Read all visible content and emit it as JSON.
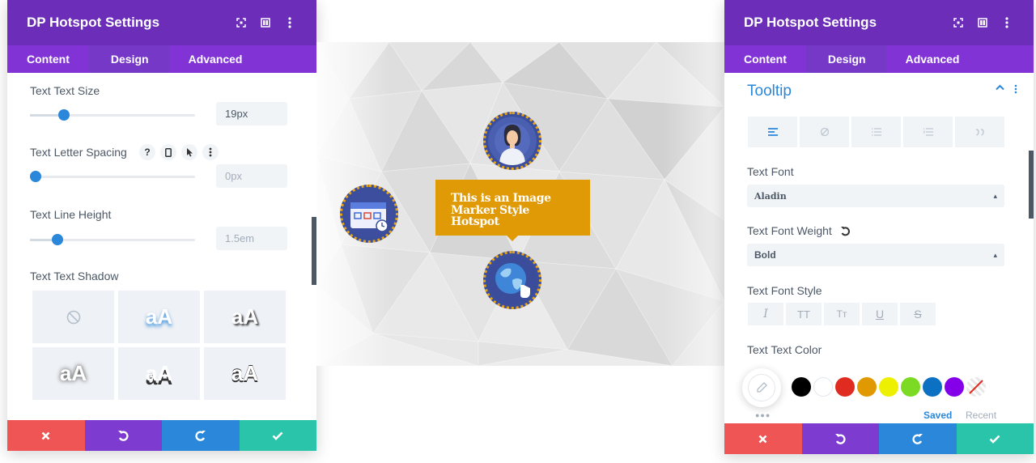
{
  "left_panel": {
    "title": "DP Hotspot Settings",
    "tabs": [
      {
        "label": "Content"
      },
      {
        "label": "Design"
      },
      {
        "label": "Advanced"
      }
    ],
    "text_size": {
      "label": "Text Text Size",
      "value": "19px",
      "slider_fraction": 0.2
    },
    "letter_spacing": {
      "label": "Text Letter Spacing",
      "value": "0px",
      "slider_fraction": 0.03
    },
    "line_height": {
      "label": "Text Line Height",
      "value": "1.5em",
      "slider_fraction": 0.17
    },
    "text_shadow": {
      "label": "Text Text Shadow",
      "presets": [
        "aA",
        "aA",
        "aA",
        "aA",
        "aA"
      ]
    }
  },
  "canvas": {
    "tooltip_text": "This is an Image Marker Style Hotspot"
  },
  "right_panel": {
    "title": "DP Hotspot Settings",
    "tabs": [
      {
        "label": "Content"
      },
      {
        "label": "Design"
      },
      {
        "label": "Advanced"
      }
    ],
    "section": "Tooltip",
    "text_font": {
      "label": "Text Font",
      "value": "Aladin"
    },
    "font_weight": {
      "label": "Text Font Weight",
      "value": "Bold"
    },
    "font_style": {
      "label": "Text Font Style",
      "buttons": [
        "I",
        "TT",
        "Tт",
        "U",
        "S"
      ]
    },
    "text_color": {
      "label": "Text Text Color",
      "swatches": [
        "#000000",
        "#ffffff",
        "#e02b20",
        "#e09900",
        "#edf000",
        "#7cda24",
        "#0c71c3",
        "#8300e9"
      ],
      "saved": "Saved",
      "recent": "Recent"
    }
  },
  "colors": {
    "header_purple": "#6c2eb9",
    "tabs_purple": "#8133d6",
    "accent_blue": "#2b87da",
    "tooltip_orange": "#e09a05"
  }
}
